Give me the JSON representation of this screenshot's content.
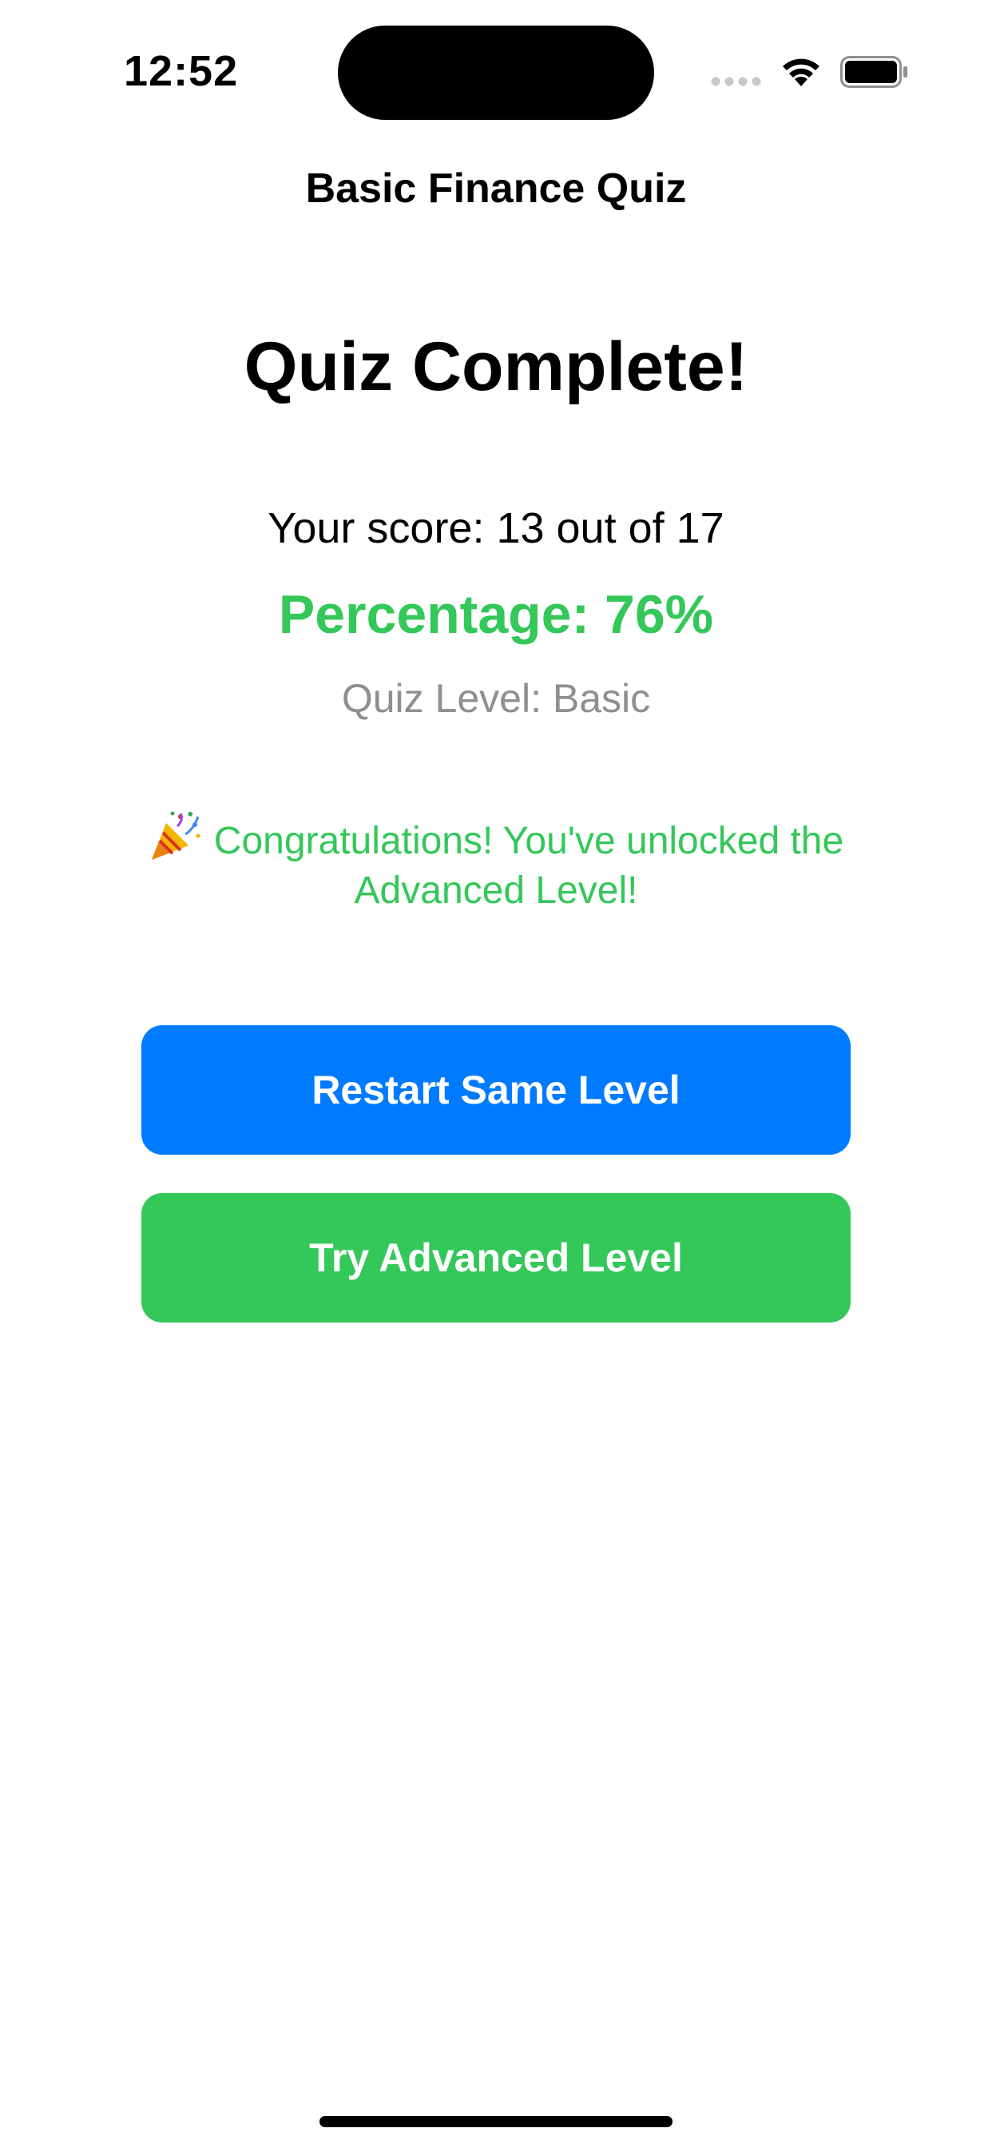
{
  "status_bar": {
    "time": "12:52",
    "icons": [
      "cellular-dots-icon",
      "wifi-icon",
      "battery-icon"
    ]
  },
  "nav": {
    "title": "Basic Finance Quiz"
  },
  "result": {
    "heading": "Quiz Complete!",
    "score_text": "Your score: 13 out of 17",
    "percentage_text": "Percentage: 76%",
    "level_text": "Quiz Level: Basic",
    "congrats_text": "Congratulations! You've unlocked the Advanced Level!",
    "congrats_icon": "party-popper-icon"
  },
  "actions": {
    "restart_label": "Restart Same Level",
    "advanced_label": "Try Advanced Level"
  },
  "colors": {
    "primary_blue": "#007aff",
    "success_green": "#34c759",
    "secondary_gray": "#8e8e93"
  }
}
